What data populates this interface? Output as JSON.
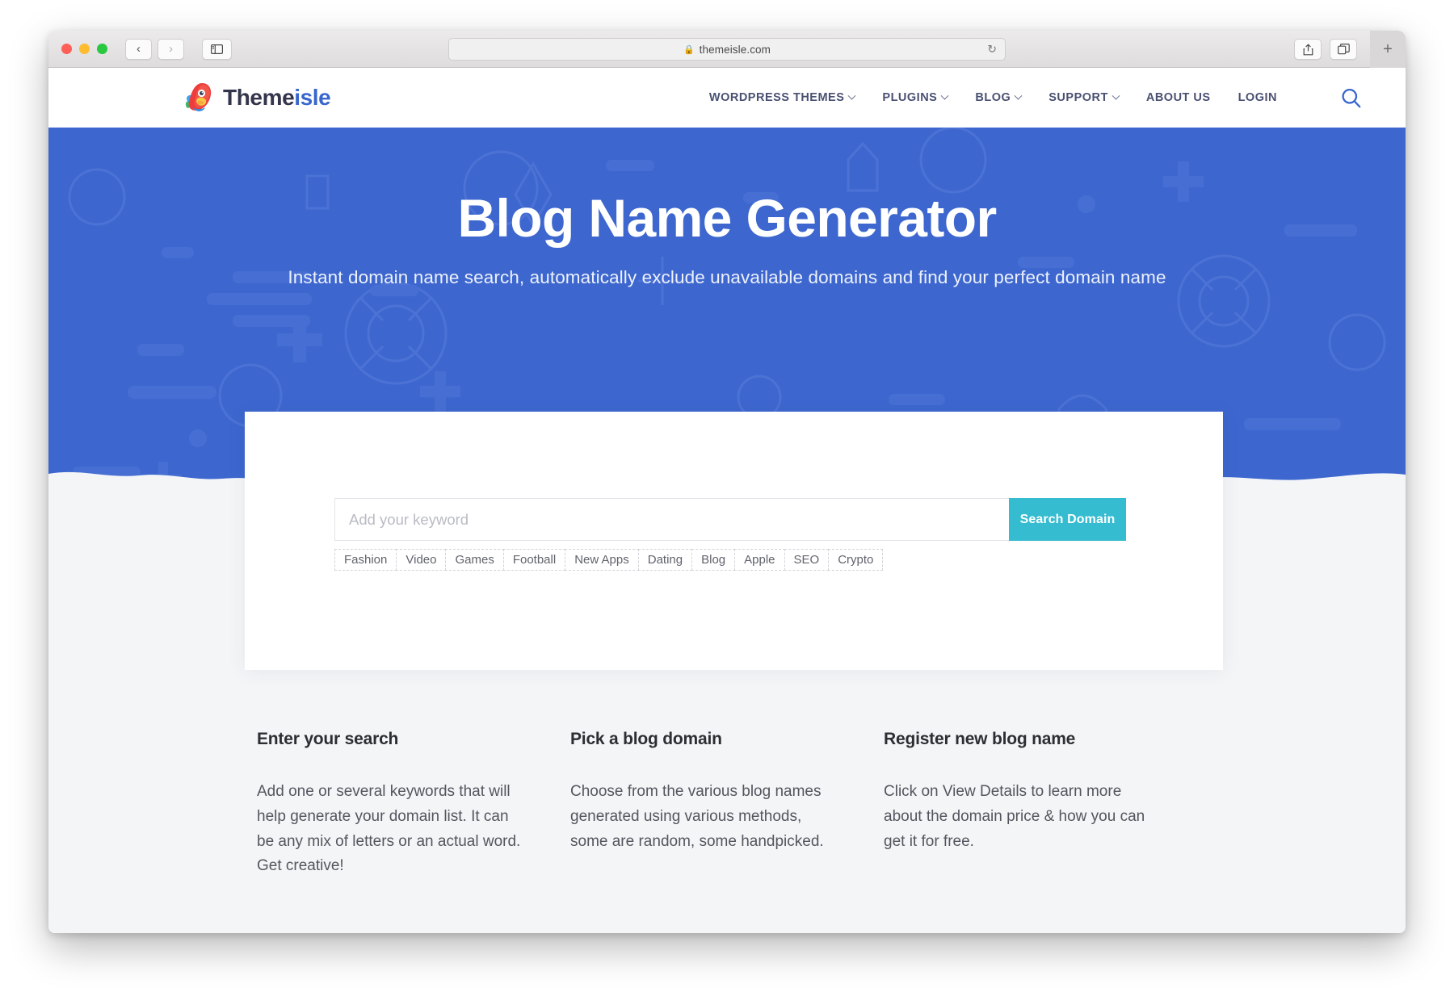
{
  "browser": {
    "url": "themeisle.com",
    "lock_icon": "lock-icon",
    "back_icon": "‹",
    "forward_icon": "›",
    "reload_icon": "↻",
    "sidebar_icon": "sidebar-icon",
    "share_icon": "share-icon",
    "tabs_icon": "tabs-icon",
    "new_tab_icon": "+"
  },
  "site": {
    "logo": {
      "text_dark": "Theme",
      "text_blue": "isle",
      "icon": "parrot-logo-icon"
    },
    "nav": [
      {
        "label": "WORDPRESS THEMES",
        "has_caret": true
      },
      {
        "label": "PLUGINS",
        "has_caret": true
      },
      {
        "label": "BLOG",
        "has_caret": true
      },
      {
        "label": "SUPPORT",
        "has_caret": true
      },
      {
        "label": "ABOUT US",
        "has_caret": false
      },
      {
        "label": "LOGIN",
        "has_caret": false
      }
    ],
    "search_icon": "search-icon"
  },
  "hero": {
    "title": "Blog Name Generator",
    "subtitle": "Instant domain name search, automatically exclude unavailable domains and find your perfect domain name",
    "bg_color": "#3d67cf"
  },
  "search": {
    "placeholder": "Add your keyword",
    "value": "",
    "button_label": "Search Domain",
    "button_color": "#35bcd0",
    "tags": [
      "Fashion",
      "Video",
      "Games",
      "Football",
      "New Apps",
      "Dating",
      "Blog",
      "Apple",
      "SEO",
      "Crypto"
    ]
  },
  "info": [
    {
      "title": "Enter your search",
      "body": "Add one or several keywords that will help generate your domain list. It can be any mix of letters or an actual word. Get creative!"
    },
    {
      "title": "Pick a blog domain",
      "body": "Choose from the various blog names generated using various methods, some are random, some handpicked."
    },
    {
      "title": "Register new blog name",
      "body": "Click on View Details to learn more about the domain price & how you can get it for free."
    }
  ]
}
